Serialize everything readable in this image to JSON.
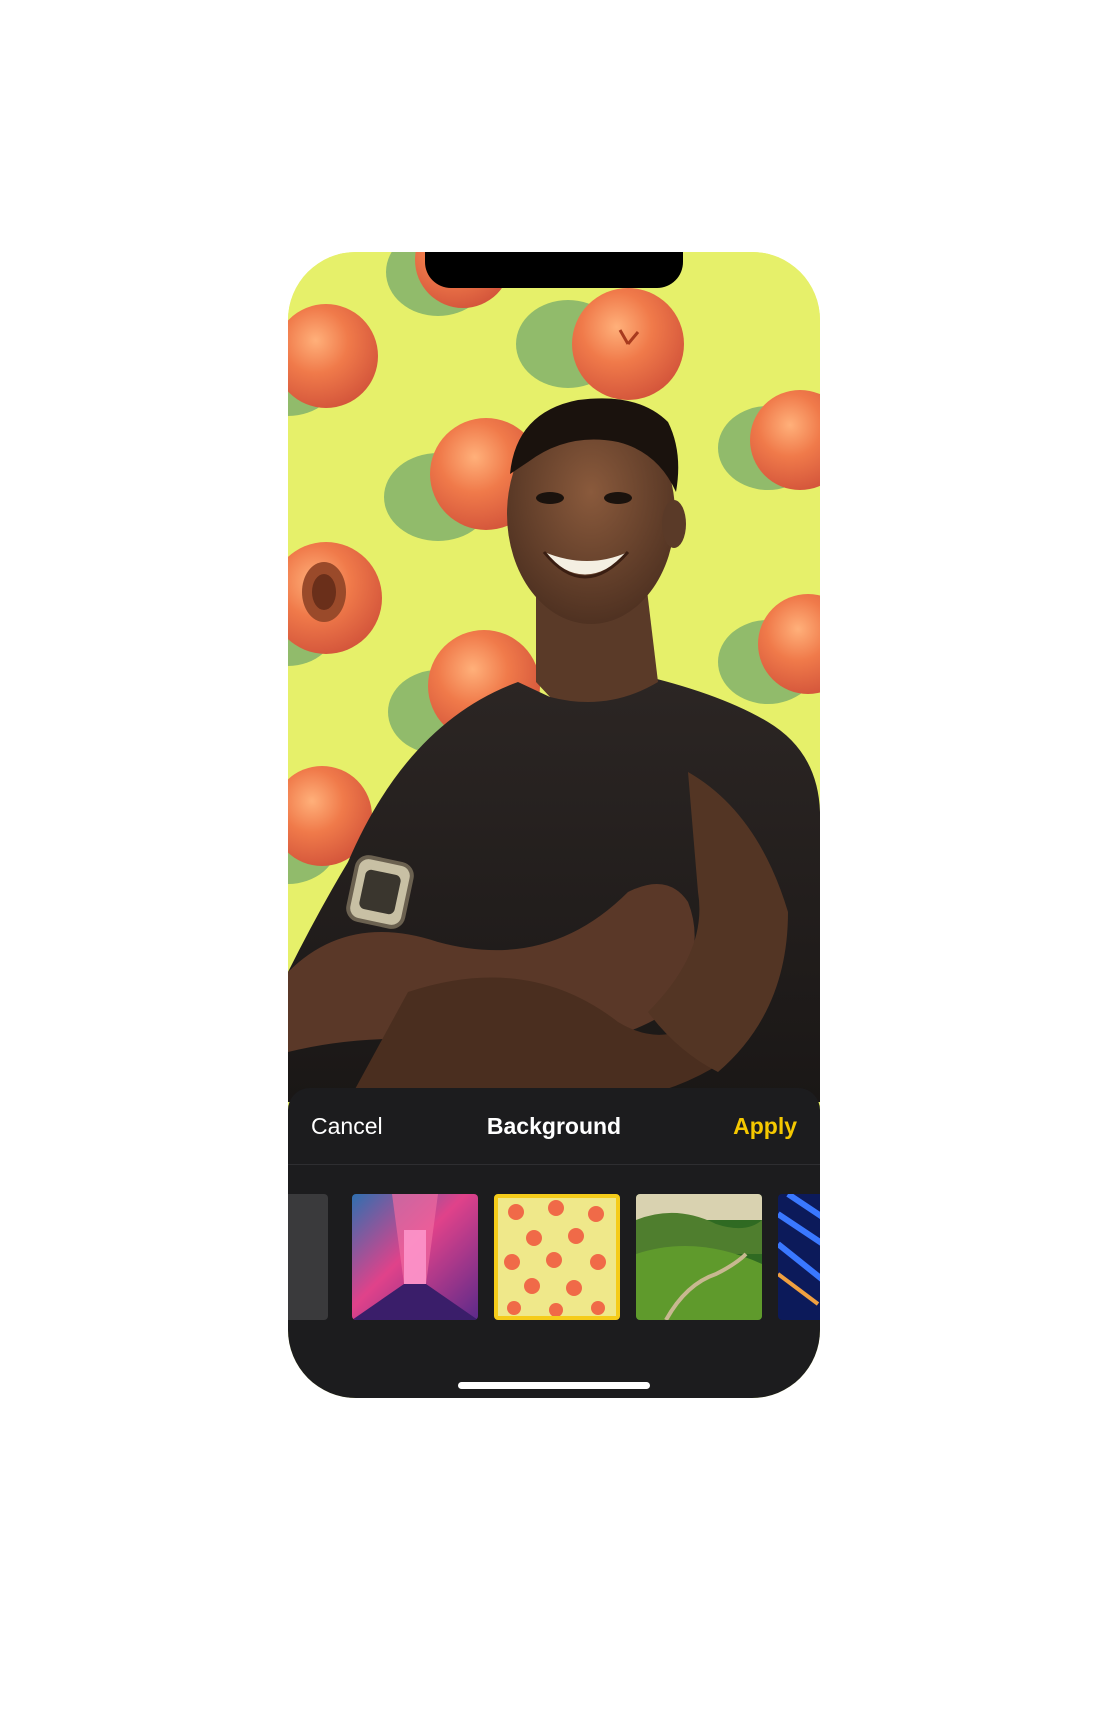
{
  "toolbar": {
    "cancel_label": "Cancel",
    "title": "Background",
    "apply_label": "Apply"
  },
  "colors": {
    "accent": "#f5c800",
    "sheet_background": "#1c1c1e",
    "photo_background": "#e6f06a",
    "selected_border": "#f5cc1a"
  },
  "backgrounds": [
    {
      "name": "gray-solid",
      "selected": false
    },
    {
      "name": "neon-corridor",
      "selected": false
    },
    {
      "name": "peach-pattern",
      "selected": true
    },
    {
      "name": "green-valley",
      "selected": false
    },
    {
      "name": "blue-neon",
      "selected": false
    }
  ]
}
